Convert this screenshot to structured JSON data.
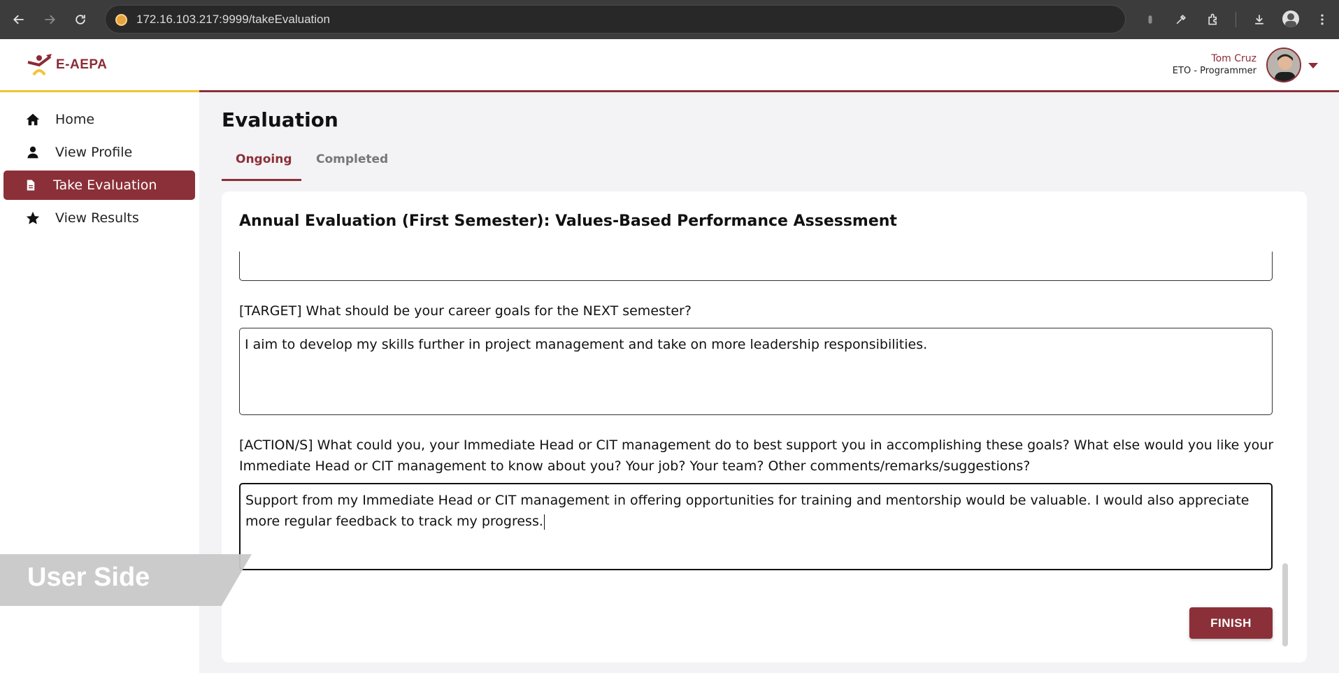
{
  "browser": {
    "url": "172.16.103.217:9999/takeEvaluation"
  },
  "header": {
    "logo_text": "E-AEPA",
    "user_name": "Tom Cruz",
    "user_role": "ETO - Programmer"
  },
  "sidebar": {
    "items": [
      {
        "label": "Home",
        "icon": "home-icon"
      },
      {
        "label": "View Profile",
        "icon": "user-icon"
      },
      {
        "label": "Take Evaluation",
        "icon": "file-icon",
        "active": true
      },
      {
        "label": "View Results",
        "icon": "star-icon"
      }
    ]
  },
  "watermark": "User Side",
  "main": {
    "title": "Evaluation",
    "tabs": [
      {
        "label": "Ongoing",
        "active": true
      },
      {
        "label": "Completed"
      }
    ],
    "card_title": "Annual Evaluation (First Semester): Values-Based Performance Assessment",
    "questions": [
      {
        "label": "[TARGET] What should be your career goals for the NEXT semester?",
        "answer": "I aim to develop my skills further in project management and take on more leadership responsibilities."
      },
      {
        "label": "[ACTION/S] What could you, your Immediate Head or CIT management do to best support you in accomplishing these goals? What else would you like your Immediate Head or CIT management to know about you? Your job? Your team? Other comments/remarks/suggestions?",
        "answer": "Support from my Immediate Head or CIT management in offering opportunities for training and mentorship would be valuable. I would also appreciate more regular feedback to track my progress."
      }
    ],
    "finish_label": "FINISH"
  },
  "colors": {
    "brand": "#8b3038",
    "accent_gold": "#f2c434"
  }
}
